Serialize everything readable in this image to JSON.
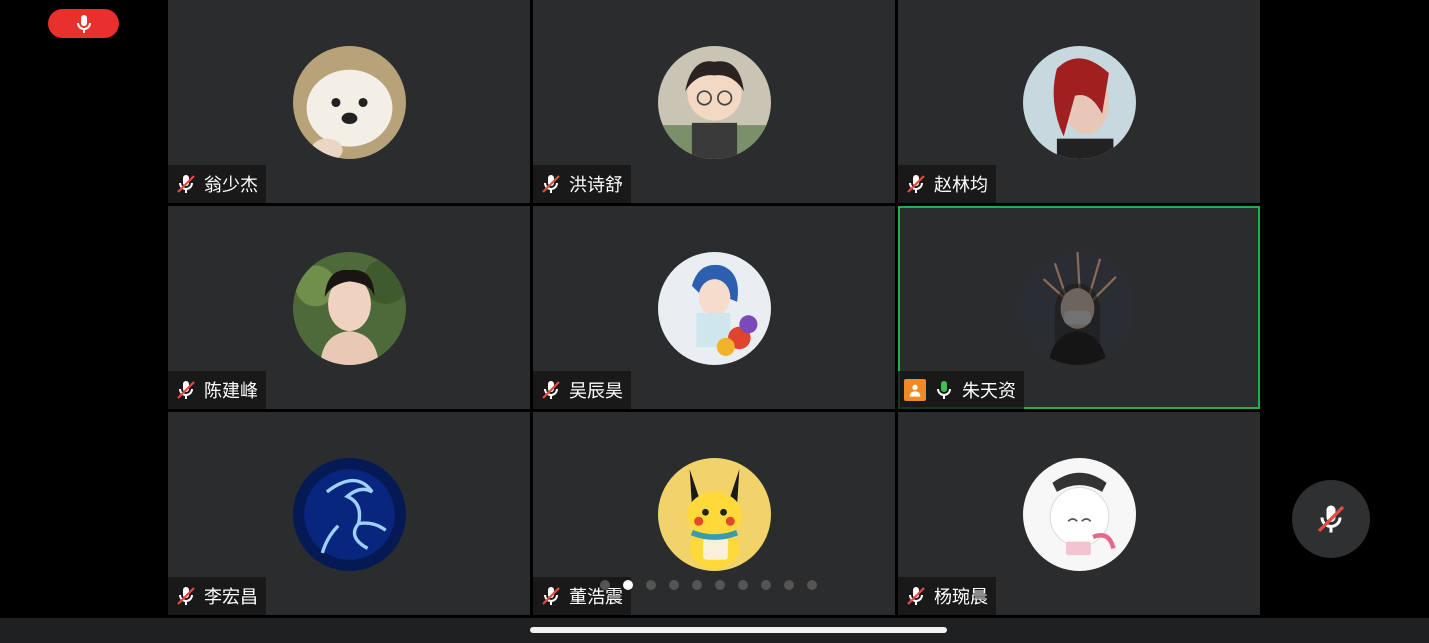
{
  "recording": {
    "icon": "mic-icon",
    "color": "#e8312c"
  },
  "participants": [
    {
      "name": "翁少杰",
      "mic": "muted",
      "avatar": "dog"
    },
    {
      "name": "洪诗舒",
      "mic": "muted",
      "avatar": "cartoon-boy"
    },
    {
      "name": "赵林均",
      "mic": "muted",
      "avatar": "red-hair-portrait"
    },
    {
      "name": "陈建峰",
      "mic": "muted",
      "avatar": "girl-portrait"
    },
    {
      "name": "吴辰昊",
      "mic": "muted",
      "avatar": "anime-figure"
    },
    {
      "name": "朱天资",
      "mic": "active",
      "avatar": "masked-girl",
      "host": true,
      "speaking": true
    },
    {
      "name": "李宏昌",
      "mic": "muted",
      "avatar": "blue-scorpion"
    },
    {
      "name": "董浩震",
      "mic": "muted",
      "avatar": "pikachu"
    },
    {
      "name": "杨琬晨",
      "mic": "muted",
      "avatar": "anime-girl"
    }
  ],
  "pagination": {
    "total": 10,
    "current": 2
  },
  "controls": {
    "mute_button_icon": "mic-off-icon"
  },
  "colors": {
    "active_border": "#23b04a",
    "active_mic": "#3ac255",
    "host_badge": "#f08a24",
    "muted": "#e84a40"
  }
}
